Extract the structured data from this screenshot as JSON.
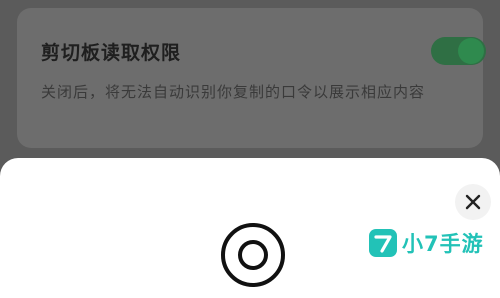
{
  "settings": {
    "clipboard_permission": {
      "title": "剪切板读取权限",
      "description": "关闭后，将无法自动识别你复制的口令以展示相应内容",
      "enabled": true
    }
  },
  "sheet": {
    "close_icon": "close-icon",
    "center_icon": "ring-icon"
  },
  "watermark": {
    "text": "小7手游",
    "color": "#22c2b7"
  },
  "colors": {
    "toggle_on": "#2f8a4e",
    "overlay_bg": "#5b5b5b",
    "sheet_bg": "#ffffff"
  }
}
